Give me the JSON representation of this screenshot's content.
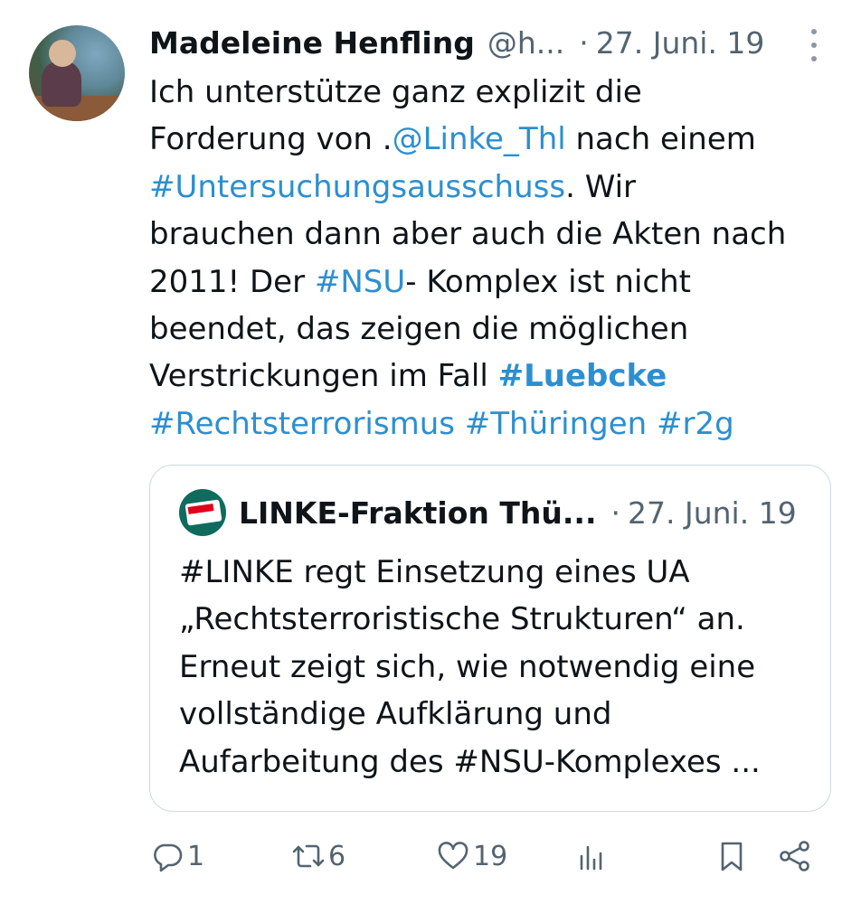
{
  "author": {
    "name": "Madeleine Henfling",
    "handle": "@h...",
    "separator": "·",
    "date": "27. Juni. 19"
  },
  "tweet_lines": [
    [
      {
        "t": "Ich unterstütze ganz explizit die",
        "k": "text"
      }
    ],
    [
      {
        "t": "Forderung von .",
        "k": "text"
      },
      {
        "t": "@Linke_Thl",
        "k": "link"
      },
      {
        "t": " nach einem",
        "k": "text"
      }
    ],
    [
      {
        "t": "#Untersuchungsausschuss",
        "k": "link"
      },
      {
        "t": ". Wir",
        "k": "text"
      }
    ],
    [
      {
        "t": "brauchen dann aber auch die Akten nach",
        "k": "text"
      }
    ],
    [
      {
        "t": "2011! Der ",
        "k": "text"
      },
      {
        "t": "#NSU",
        "k": "link"
      },
      {
        "t": "- Komplex ist nicht",
        "k": "text"
      }
    ],
    [
      {
        "t": "beendet, das zeigen die möglichen",
        "k": "text"
      }
    ],
    [
      {
        "t": "Verstrickungen im Fall ",
        "k": "text"
      },
      {
        "t": "#Luebcke",
        "k": "link-bold"
      }
    ],
    [
      {
        "t": "#Rechtsterrorismus",
        "k": "link"
      },
      {
        "t": " ",
        "k": "text"
      },
      {
        "t": "#Thüringen",
        "k": "link"
      },
      {
        "t": " ",
        "k": "text"
      },
      {
        "t": "#r2g",
        "k": "link"
      }
    ]
  ],
  "quote": {
    "name": "LINKE-Fraktion Thü...",
    "separator": "·",
    "date": "27. Juni. 19",
    "lines": [
      "#LINKE regt Einsetzung eines UA",
      "„Rechtsterroristische Strukturen“ an.",
      "Erneut zeigt sich, wie notwendig eine",
      "vollständige Aufklärung und",
      "Aufarbeitung des #NSU-Komplexes ..."
    ]
  },
  "actions": {
    "replies": "1",
    "retweets": "6",
    "likes": "19"
  },
  "icons": {
    "reply": "reply-icon",
    "retweet": "retweet-icon",
    "like": "heart-icon",
    "views": "views-icon",
    "bookmark": "bookmark-icon",
    "share": "share-icon",
    "more": "more-icon"
  },
  "colors": {
    "link": "#2c8fd0",
    "text": "#0f1419",
    "muted": "#536471",
    "border": "#cfd9de"
  }
}
